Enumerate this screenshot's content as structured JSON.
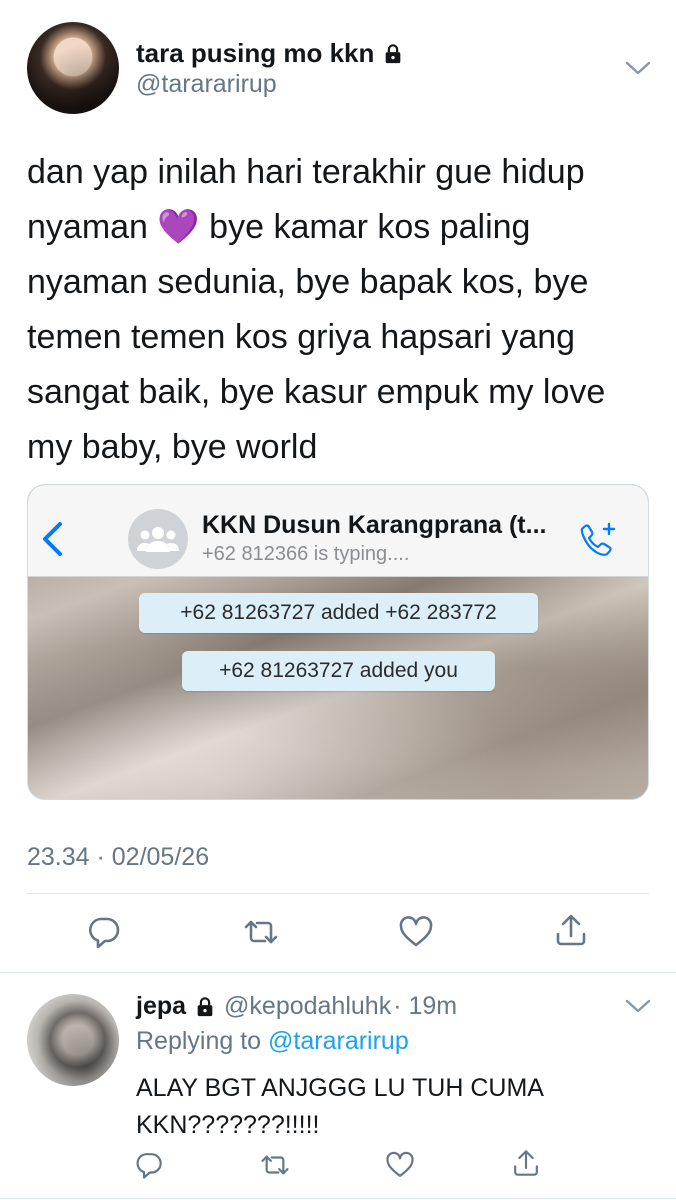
{
  "tweet": {
    "author_name": "tara pusing mo kkn",
    "author_handle": "@tarararirup",
    "text": "dan yap inilah hari terakhir gue hidup nyaman 💜 bye kamar kos paling nyaman sedunia, bye bapak kos, bye temen temen kos griya hapsari yang sangat baik, bye kasur empuk my love my baby, bye world",
    "timestamp": "23.34 · 02/05/26"
  },
  "embedded_chat": {
    "title": "KKN Dusun Karangprana (t...",
    "subtitle": "+62 812366 is typing....",
    "messages": [
      "+62 81263727 added +62 283772",
      "+62 81263727 added you"
    ]
  },
  "reply": {
    "author_name": "jepa",
    "author_handle": "@kepodahluhk",
    "time": "· 19m",
    "replying_prefix": "Replying to",
    "replying_handle": "@tarararirup",
    "text": "ALAY BGT ANJGGG LU TUH CUMA KKN???????!!!!!"
  },
  "colors": {
    "accent": "#1da1f2",
    "secondary_text": "#657786",
    "icon": "#657786",
    "whatsapp_blue": "#007aff"
  },
  "icons": [
    "lock-icon",
    "chevron-down-icon",
    "reply-icon",
    "retweet-icon",
    "like-icon",
    "share-icon",
    "back-icon",
    "group-icon",
    "add-call-icon"
  ]
}
